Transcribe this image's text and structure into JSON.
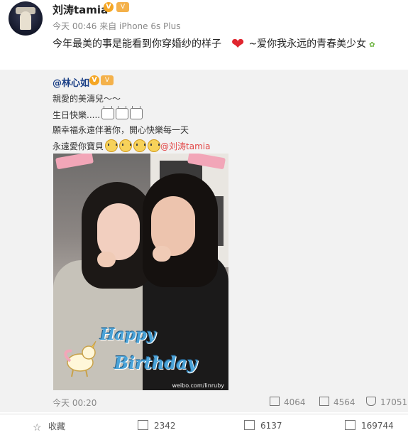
{
  "post": {
    "username": "刘涛tamia",
    "verified_mark": "V",
    "vip_mark": "V",
    "meta": "今天 00:46 来自 iPhone 6s Plus",
    "text_before": "今年最美的事是能看到你穿婚纱的样子",
    "text_after": "~爱你我永远的青春美少女",
    "heart_emoji": "❤",
    "leaf_emoji": "✿"
  },
  "repost": {
    "username": "@林心如",
    "verified_mark": "V",
    "vip_mark": "V",
    "line1": "親愛的美濤兒～～",
    "line2": "生日快樂.....",
    "line3": "願幸福永遠伴著你，開心快樂每一天",
    "line4": "永遠愛你寶貝",
    "mention": "@刘涛tamia",
    "image_text_1": "Happy",
    "image_text_2": "Birthday",
    "watermark": "weibo.com/linruby",
    "time": "今天 00:20",
    "stats": {
      "reposts": "4064",
      "comments": "4564",
      "likes": "170511"
    }
  },
  "bottom_bar": {
    "favorite_label": "收藏",
    "repost_count": "2342",
    "comment_count": "6137",
    "like_count": "169744"
  },
  "colors": {
    "link": "#1a3f86",
    "mention": "#e24646",
    "badge": "#f5a623",
    "heart": "#e0262f"
  }
}
